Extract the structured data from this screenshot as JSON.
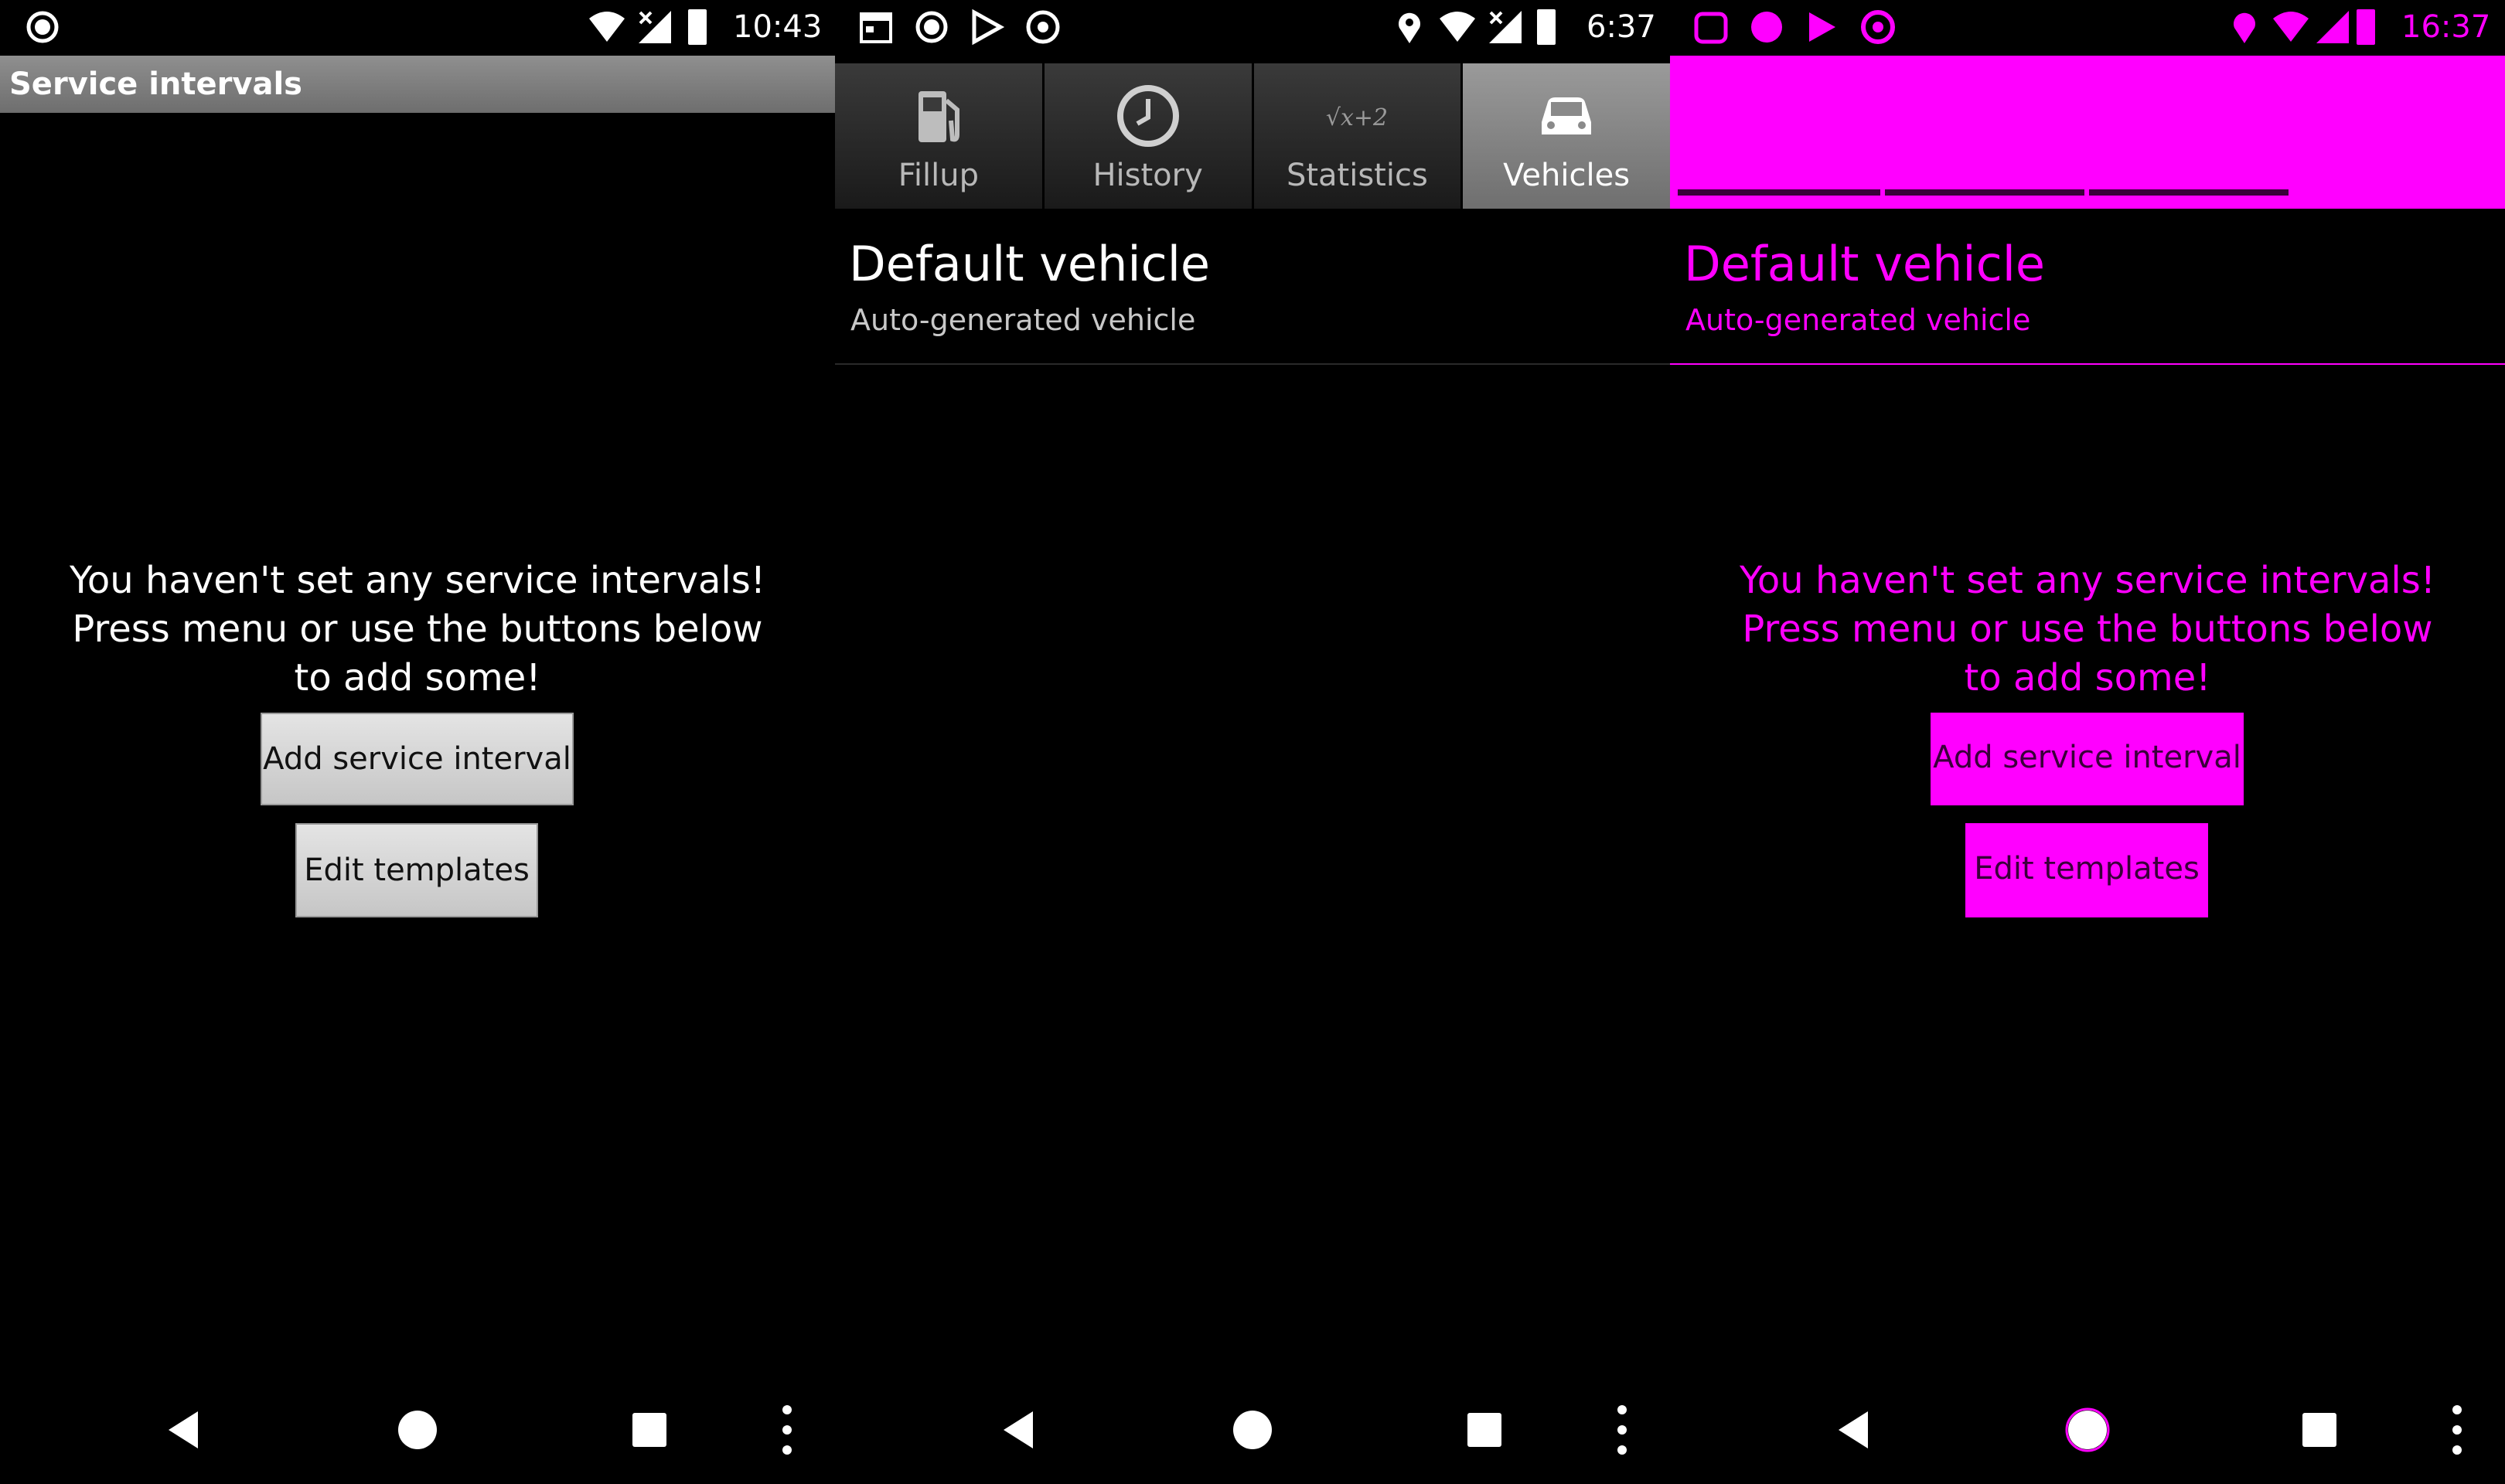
{
  "panel1": {
    "status": {
      "time": "10:43"
    },
    "title": "Service intervals",
    "empty_message": {
      "line1": "You haven't set any service intervals!",
      "line2": "Press menu or use the buttons below",
      "line3": "to add some!"
    },
    "buttons": {
      "add": "Add service interval",
      "edit": "Edit templates"
    }
  },
  "panel2": {
    "status": {
      "time": "6:37"
    },
    "tabs": [
      {
        "label": "Fillup",
        "icon": "fuel-pump-icon"
      },
      {
        "label": "History",
        "icon": "clock-icon"
      },
      {
        "label": "Statistics",
        "icon": "formula-icon",
        "icon_text": "√x+2"
      },
      {
        "label": "Vehicles",
        "icon": "car-icon",
        "active": true
      }
    ],
    "vehicle": {
      "name": "Default vehicle",
      "description": "Auto-generated vehicle"
    }
  },
  "panel3": {
    "status": {
      "time": "16:37"
    },
    "vehicle": {
      "name": "Default vehicle",
      "description": "Auto-generated vehicle"
    },
    "empty_message": {
      "line1": "You haven't set any service intervals!",
      "line2": "Press menu or use the buttons below",
      "line3": "to add some!"
    },
    "buttons": {
      "add": "Add service interval",
      "edit": "Edit templates"
    }
  },
  "colors": {
    "background": "#000000",
    "text": "#ffffff",
    "highlight": "#ff00ff",
    "titlebar": "#7f7f7f"
  }
}
